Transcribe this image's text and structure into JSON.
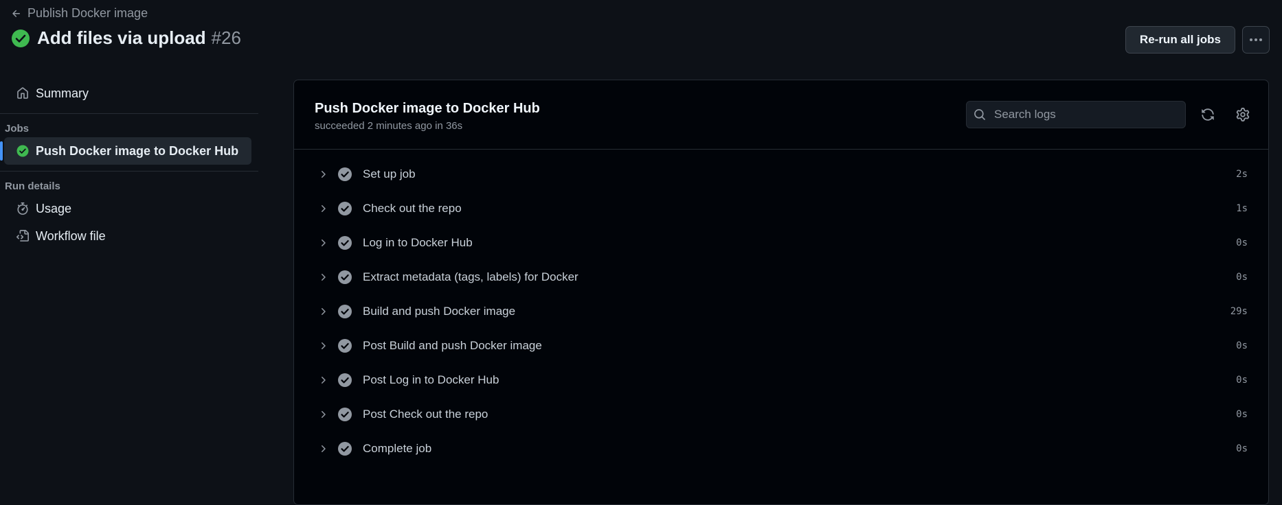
{
  "header": {
    "back_label": "Publish Docker image",
    "run_title": "Add files via upload",
    "run_number": "#26",
    "rerun_label": "Re-run all jobs"
  },
  "sidebar": {
    "summary_label": "Summary",
    "jobs_heading": "Jobs",
    "jobs": [
      {
        "label": "Push Docker image to Docker Hub"
      }
    ],
    "run_details_heading": "Run details",
    "usage_label": "Usage",
    "workflow_file_label": "Workflow file"
  },
  "job": {
    "title": "Push Docker image to Docker Hub",
    "subtitle": "succeeded 2 minutes ago in 36s",
    "search_placeholder": "Search logs"
  },
  "steps": [
    {
      "name": "Set up job",
      "duration": "2s"
    },
    {
      "name": "Check out the repo",
      "duration": "1s"
    },
    {
      "name": "Log in to Docker Hub",
      "duration": "0s"
    },
    {
      "name": "Extract metadata (tags, labels) for Docker",
      "duration": "0s"
    },
    {
      "name": "Build and push Docker image",
      "duration": "29s"
    },
    {
      "name": "Post Build and push Docker image",
      "duration": "0s"
    },
    {
      "name": "Post Log in to Docker Hub",
      "duration": "0s"
    },
    {
      "name": "Post Check out the repo",
      "duration": "0s"
    },
    {
      "name": "Complete job",
      "duration": "0s"
    }
  ],
  "colors": {
    "background": "#0d1117",
    "panel": "#010409",
    "success": "#3fb950",
    "accent": "#4493f8",
    "muted_text": "#9198a1"
  }
}
